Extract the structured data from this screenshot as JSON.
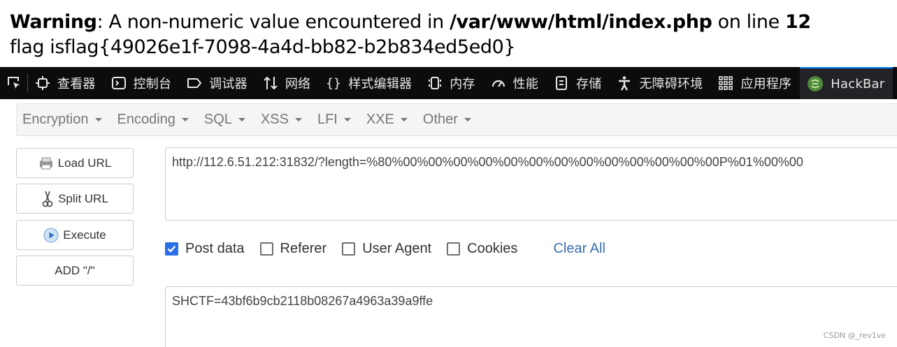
{
  "php_output": {
    "warning_label": "Warning",
    "warning_message": ": A non-numeric value encountered in ",
    "warning_file": "/var/www/html/index.php",
    "warning_on_line": " on line ",
    "warning_line": "12",
    "flag_line": "flag isflag{49026e1f-7098-4a4d-bb82-b2b834ed5ed0}"
  },
  "devtools": {
    "tabs": [
      {
        "label": "查看器",
        "icon": "inspector-icon"
      },
      {
        "label": "控制台",
        "icon": "console-icon"
      },
      {
        "label": "调试器",
        "icon": "debugger-icon"
      },
      {
        "label": "网络",
        "icon": "network-icon"
      },
      {
        "label": "样式编辑器",
        "icon": "style-editor-icon"
      },
      {
        "label": "内存",
        "icon": "memory-icon"
      },
      {
        "label": "性能",
        "icon": "performance-icon"
      },
      {
        "label": "存储",
        "icon": "storage-icon"
      },
      {
        "label": "无障碍环境",
        "icon": "accessibility-icon"
      },
      {
        "label": "应用程序",
        "icon": "application-icon"
      },
      {
        "label": "HackBar",
        "icon": "hackbar-icon",
        "selected": true
      }
    ]
  },
  "hackbar": {
    "menu": [
      {
        "label": "Encryption"
      },
      {
        "label": "Encoding"
      },
      {
        "label": "SQL"
      },
      {
        "label": "XSS"
      },
      {
        "label": "LFI"
      },
      {
        "label": "XXE"
      },
      {
        "label": "Other"
      }
    ],
    "buttons": {
      "load_url": "Load URL",
      "split_url": "Split URL",
      "execute": "Execute",
      "add_slash": "ADD \"/\""
    },
    "url_value": "http://112.6.51.212:31832/?length=%80%00%00%00%00%00%00%00%00%00%00%00%00%00P%01%00%00",
    "options": {
      "post_data": {
        "label": "Post data",
        "checked": true
      },
      "referer": {
        "label": "Referer",
        "checked": false
      },
      "user_agent": {
        "label": "User Agent",
        "checked": false
      },
      "cookies": {
        "label": "Cookies",
        "checked": false
      },
      "clear_all": "Clear All"
    },
    "post_body": "SHCTF=43bf6b9cb2118b08267a4963a39a9ffe"
  },
  "watermark": "CSDN @_rev1ve",
  "colors": {
    "devtools_bg": "#0c0c0d",
    "selected_tab_accent": "#0a84ff",
    "checkbox_checked": "#2a6fe6",
    "link": "#3a6fb0"
  }
}
